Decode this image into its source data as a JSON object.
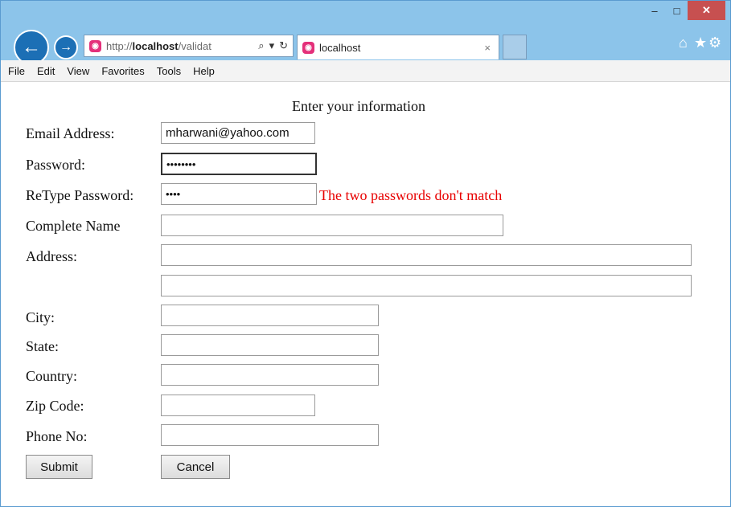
{
  "window": {
    "minimize_glyph": "–",
    "maximize_glyph": "□",
    "close_glyph": "✕"
  },
  "browser": {
    "back_glyph": "←",
    "forward_glyph": "→",
    "address": {
      "prefix": "http://",
      "host": "localhost",
      "path": "/validat",
      "search_glyph": "⌕",
      "dropdown_glyph": "▾",
      "refresh_glyph": "↻"
    },
    "tab": {
      "title": "localhost",
      "close_glyph": "×"
    },
    "tools": {
      "home_glyph": "⌂",
      "favorites_glyph": "★",
      "settings_glyph": "⚙"
    }
  },
  "menu": [
    "File",
    "Edit",
    "View",
    "Favorites",
    "Tools",
    "Help"
  ],
  "form": {
    "title": "Enter your information",
    "labels": {
      "email": "Email Address:",
      "password": "Password:",
      "retype": "ReType Password:",
      "complete_name": "Complete Name",
      "address": "Address:",
      "city": "City:",
      "state": "State:",
      "country": "Country:",
      "zip": "Zip Code:",
      "phone": "Phone No:"
    },
    "values": {
      "email": "mharwani@yahoo.com",
      "password": "••••••••",
      "retype": "••••",
      "complete_name": "",
      "address_line1": "",
      "address_line2": "",
      "city": "",
      "state": "",
      "country": "",
      "zip": "",
      "phone": ""
    },
    "error_message": "The two passwords don't match",
    "submit_label": "Submit",
    "cancel_label": "Cancel"
  },
  "colors": {
    "error": "#e80000",
    "title_bar": "#8cc4ea",
    "close_button": "#c75050"
  }
}
